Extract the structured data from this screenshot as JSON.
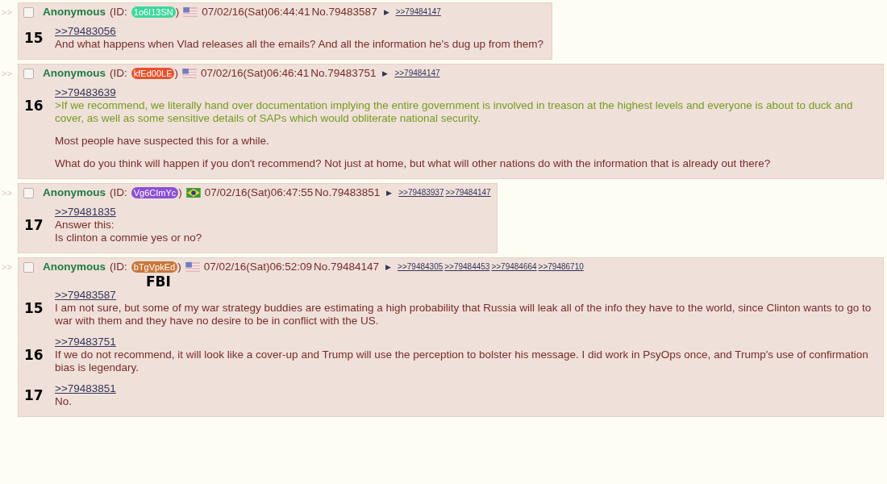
{
  "posts": [
    {
      "side_arrow": ">>",
      "checked": false,
      "name": "Anonymous",
      "id_prefix": "(ID:",
      "id": {
        "text": "1o6I13SN",
        "color": "#3dd89c"
      },
      "id_suffix": ")",
      "flag": {
        "kind": "us"
      },
      "datetime": "07/02/16(Sat)06:44:41",
      "number": "No.79483587",
      "arrow": "▶",
      "backlinks": [
        ">>79484147"
      ],
      "blocks": [
        {
          "num": "15",
          "quote": ">>79483056",
          "paragraphs": [
            {
              "kind": "text",
              "lines": [
                "And what happens when Vlad releases all the emails? And all the information he's dug up from them?"
              ]
            }
          ]
        }
      ]
    },
    {
      "side_arrow": ">>",
      "checked": false,
      "name": "Anonymous",
      "id_prefix": "(ID:",
      "id": {
        "text": "kfEd00LE",
        "color": "#e9502a"
      },
      "id_suffix": ")",
      "flag": {
        "kind": "us"
      },
      "datetime": "07/02/16(Sat)06:46:41",
      "number": "No.79483751",
      "arrow": "▶",
      "backlinks": [
        ">>79484147"
      ],
      "blocks": [
        {
          "num": "16",
          "quote": ">>79483639",
          "paragraphs": [
            {
              "kind": "greentext",
              "lines": [
                ">If we recommend, we literally hand over documentation implying the entire government is involved in treason at the highest levels and everyone is about to duck and cover, as well as some sensitive details of SAPs which would obliterate national security."
              ]
            },
            {
              "kind": "text",
              "lines": [
                "Most people have suspected this for a while."
              ]
            },
            {
              "kind": "text",
              "lines": [
                "What do you think will happen if you don't recommend? Not just at home, but what will other nations do with the information that is already out there?"
              ]
            }
          ]
        }
      ]
    },
    {
      "side_arrow": ">>",
      "checked": false,
      "name": "Anonymous",
      "id_prefix": "(ID:",
      "id": {
        "text": "Vg6CImYc",
        "color": "#8c4fd6"
      },
      "id_suffix": ")",
      "flag": {
        "kind": "br"
      },
      "datetime": "07/02/16(Sat)06:47:55",
      "number": "No.79483851",
      "arrow": "▶",
      "backlinks": [
        ">>79483937",
        ">>79484147"
      ],
      "blocks": [
        {
          "num": "17",
          "quote": ">>79481835",
          "paragraphs": [
            {
              "kind": "text",
              "lines": [
                "Answer this:",
                "Is clinton a commie yes or no?"
              ]
            }
          ]
        }
      ]
    },
    {
      "side_arrow": ">>",
      "checked": false,
      "name": "Anonymous",
      "id_prefix": "(ID:",
      "id": {
        "text": "bTgVpkEd",
        "color": "#c9773a"
      },
      "id_suffix": ")",
      "flag": {
        "kind": "us"
      },
      "datetime": "07/02/16(Sat)06:52:09",
      "number": "No.79484147",
      "arrow": "▶",
      "backlinks": [
        ">>79484305",
        ">>79484453",
        ">>79484664",
        ">>79486710"
      ],
      "annotation": "FBI",
      "blocks": [
        {
          "num": "15",
          "quote": ">>79483587",
          "paragraphs": [
            {
              "kind": "text",
              "lines": [
                "I am not sure, but some of my war strategy buddies are estimating a high probability that Russia will leak all of the info they have to the world, since Clinton wants to go to war with them and they have no desire to be in conflict with the US."
              ]
            }
          ]
        },
        {
          "num": "16",
          "quote": ">>79483751",
          "paragraphs": [
            {
              "kind": "text",
              "lines": [
                "If we do not recommend, it will look like a cover-up and Trump will use the perception to bolster his message. I did work in PsyOps once, and Trump's use of confirmation bias is legendary."
              ]
            }
          ]
        },
        {
          "num": "17",
          "quote": ">>79483851",
          "paragraphs": [
            {
              "kind": "text",
              "lines": [
                "No."
              ]
            }
          ]
        }
      ]
    }
  ]
}
